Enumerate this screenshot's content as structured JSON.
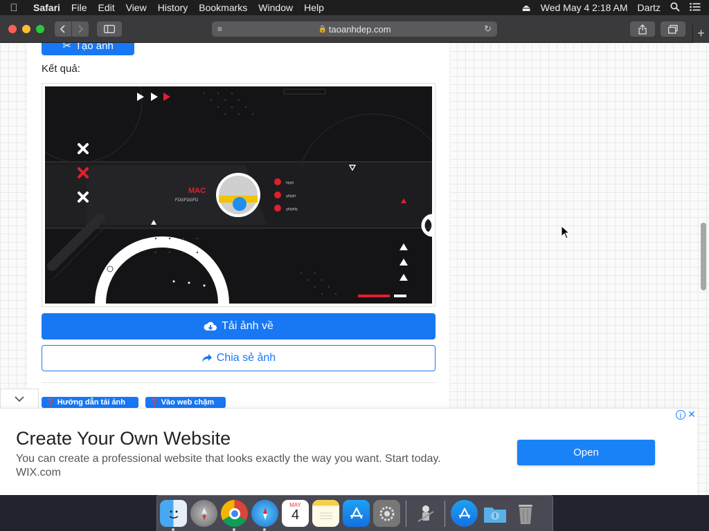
{
  "menubar": {
    "app_name": "Safari",
    "items": [
      "File",
      "Edit",
      "View",
      "History",
      "Bookmarks",
      "Window",
      "Help"
    ],
    "datetime": "Wed May 4  2:18 AM",
    "user": "Dartz"
  },
  "browser": {
    "url": "taoanhdep.com"
  },
  "page": {
    "create_button": "Tạo ảnh",
    "result_label": "Kết quả:",
    "download_button": "Tải ảnh về",
    "share_button": "Chia sẻ ảnh",
    "tag_guide": "Hướng dẫn tải ảnh",
    "tag_slow": "Vào web chậm"
  },
  "preview": {
    "name": "MAC",
    "subtitle": "FDGFDGFD",
    "contacts": [
      "fdgfd",
      "gfdgfd",
      "gfdgfdg"
    ]
  },
  "ad": {
    "title": "Create Your Own Website",
    "description": "You can create a professional website that looks exactly the way you want. Start today.",
    "source": "WIX.com",
    "open_button": "Open"
  },
  "dock": {
    "calendar_month": "MAY",
    "calendar_day": "4"
  },
  "colors": {
    "accent_blue": "#1877f2",
    "preview_red": "#e0202b"
  }
}
